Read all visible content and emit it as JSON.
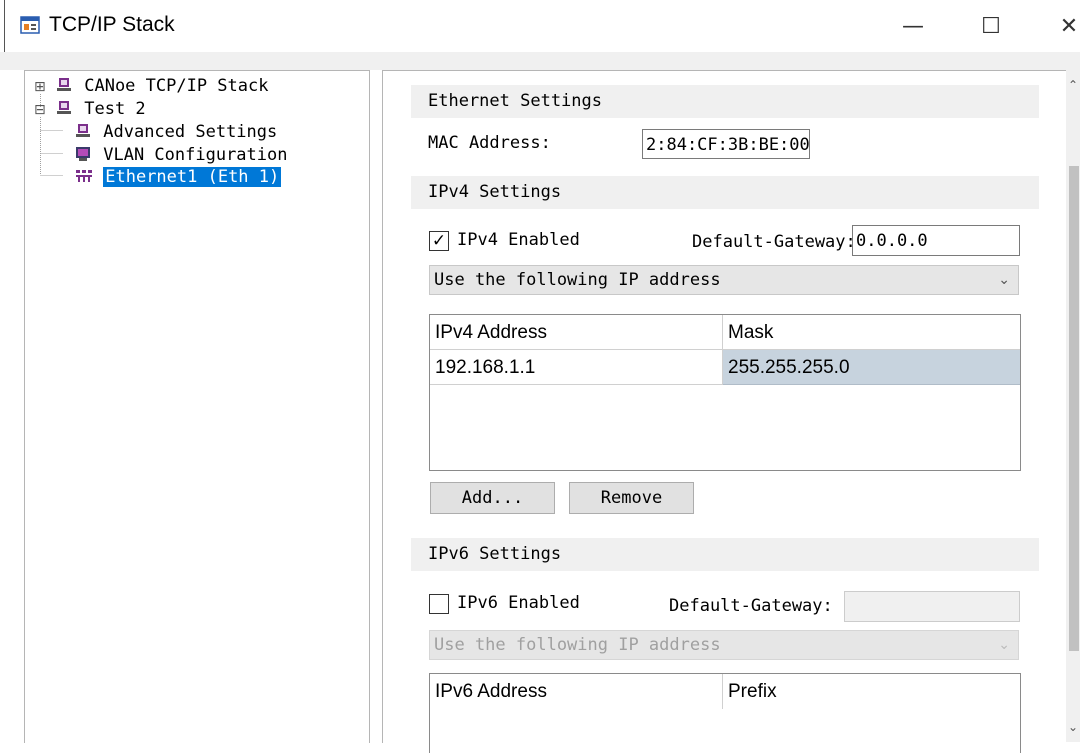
{
  "window": {
    "title": "TCP/IP Stack",
    "minimize": "—",
    "maximize": "☐",
    "close": "✕"
  },
  "tree": {
    "items": [
      {
        "expander": "⊞",
        "label": "CANoe TCP/IP Stack"
      },
      {
        "expander": "⊟",
        "label": "Test 2"
      },
      {
        "label": "Advanced Settings"
      },
      {
        "label": "VLAN Configuration"
      },
      {
        "label": "Ethernet1 (Eth 1)",
        "selected": true
      }
    ]
  },
  "ethernet": {
    "header": "Ethernet Settings",
    "mac_label": "MAC Address:",
    "mac_value": "2:84:CF:3B:BE:00"
  },
  "ipv4": {
    "header": "IPv4 Settings",
    "enabled_label": "IPv4 Enabled",
    "enabled_check": "✓",
    "gateway_label": "Default-Gateway:",
    "gateway_value": "0.0.0.0",
    "mode": "Use the following IP address",
    "columns": [
      "IPv4 Address",
      "Mask"
    ],
    "rows": [
      {
        "address": "192.168.1.1",
        "mask": "255.255.255.0"
      }
    ],
    "add_button": "Add...",
    "remove_button": "Remove"
  },
  "ipv6": {
    "header": "IPv6 Settings",
    "enabled_label": "IPv6 Enabled",
    "gateway_label": "Default-Gateway:",
    "gateway_value": "",
    "mode": "Use the following IP address",
    "columns": [
      "IPv6 Address",
      "Prefix"
    ]
  },
  "scroll": {
    "up_arrow": "⌃",
    "down_arrow": "⌄"
  },
  "colors": {
    "selection": "#0078d7",
    "section_bg": "#f0f0f0",
    "selected_cell": "#c7d3de"
  }
}
